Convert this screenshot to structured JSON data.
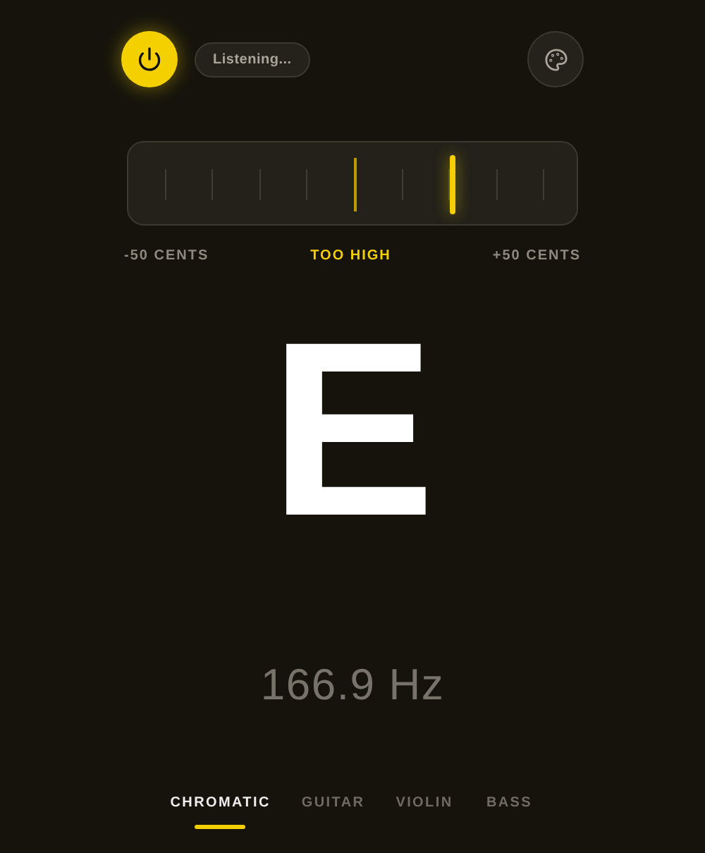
{
  "power": {
    "on": true
  },
  "status": "Listening...",
  "meter": {
    "level": 0.72,
    "left_label": "-50 CENTS",
    "center_label": "TOO HIGH",
    "right_label": "+50 CENTS"
  },
  "note": "E",
  "frequency": "166.9 Hz",
  "tabs": [
    {
      "label": "CHROMATIC",
      "selected": true
    },
    {
      "label": "GUITAR",
      "selected": false
    },
    {
      "label": "VIOLIN",
      "selected": false
    },
    {
      "label": "BASS",
      "selected": false
    }
  ]
}
